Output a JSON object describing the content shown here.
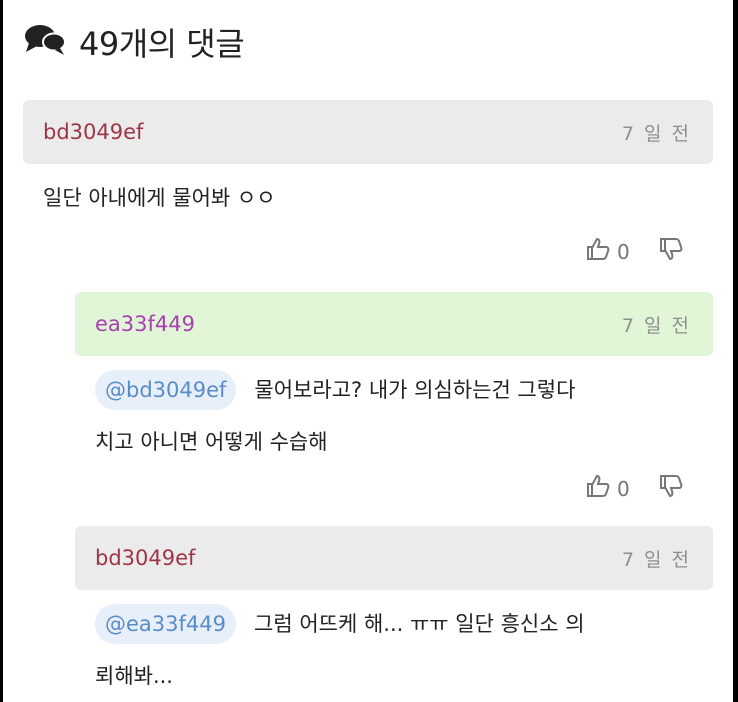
{
  "header": {
    "count_label": "49개의 댓글",
    "icon": "speech-bubbles-icon"
  },
  "comments": [
    {
      "author": "bd3049ef",
      "time": "7 일 전",
      "mention": "",
      "text": "일단 아내에게 물어봐 ㅇㅇ",
      "likes": "0"
    },
    {
      "author": "ea33f449",
      "time": "7 일 전",
      "mention": "@bd3049ef",
      "text_line1": "물어보라고? 내가 의심하는건 그렇다",
      "text_line2": "치고 아니면 어떻게 수습해",
      "likes": "0"
    },
    {
      "author": "bd3049ef",
      "time": "7 일 전",
      "mention": "@ea33f449",
      "text_line1": "그럼 어뜨케 해... ㅠㅠ 일단 흥신소 의",
      "text_line2": "뢰해봐...",
      "likes": ""
    }
  ],
  "colors": {
    "author_red": "#9e3547",
    "author_purple": "#a940b1",
    "header_gray": "#ebebeb",
    "header_green": "#e1f6d7",
    "mention_bg": "#e7effa",
    "mention_text": "#5a8cc8"
  }
}
